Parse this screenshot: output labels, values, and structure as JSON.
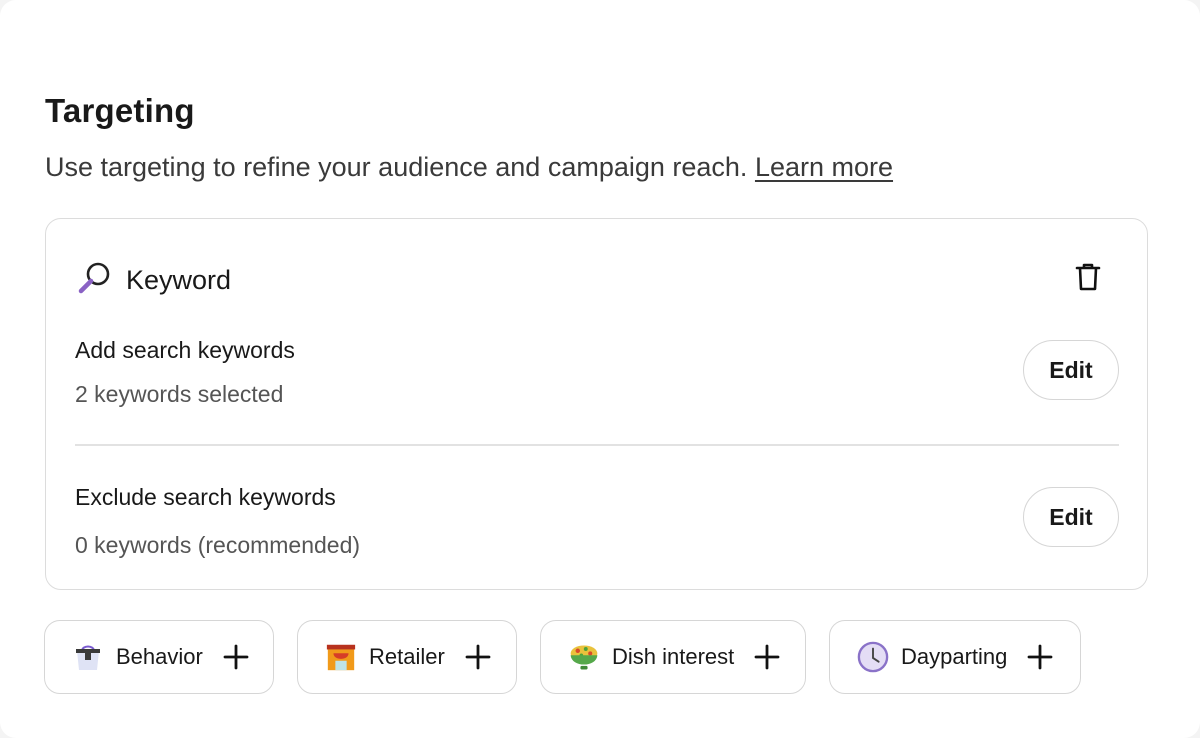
{
  "header": {
    "title": "Targeting",
    "subtitle": "Use targeting to refine your audience and campaign reach.",
    "learn_more": "Learn more"
  },
  "keyword_card": {
    "title": "Keyword",
    "icon": "magnifier-icon",
    "delete_icon": "trash-icon",
    "add": {
      "title": "Add search keywords",
      "status": "2 keywords selected",
      "button": "Edit"
    },
    "exclude": {
      "title": "Exclude search keywords",
      "status": "0 keywords (recommended)",
      "button": "Edit"
    }
  },
  "chips": [
    {
      "label": "Behavior",
      "icon": "shopping-bag-icon"
    },
    {
      "label": "Retailer",
      "icon": "storefront-icon"
    },
    {
      "label": "Dish interest",
      "icon": "food-bowl-icon"
    },
    {
      "label": "Dayparting",
      "icon": "clock-icon"
    }
  ],
  "colors": {
    "text": "#191919",
    "border": "#dcdcdc",
    "muted": "#555555"
  }
}
